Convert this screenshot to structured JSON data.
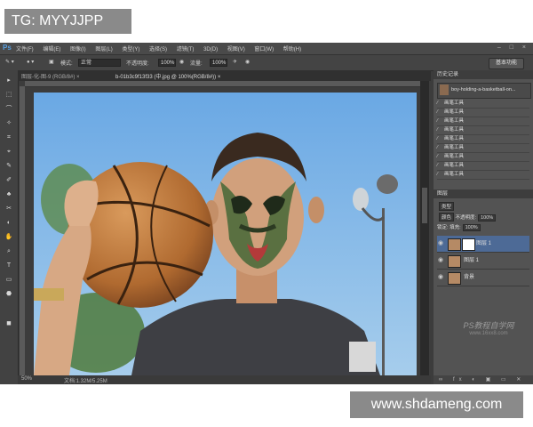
{
  "tag": "TG: MYYJJPP",
  "site_url": "www.shdameng.com",
  "app": {
    "logo": "Ps",
    "menu": [
      "文件(F)",
      "编辑(E)",
      "图像(I)",
      "图层(L)",
      "类型(Y)",
      "选择(S)",
      "滤镜(T)",
      "3D(D)",
      "视图(V)",
      "窗口(W)",
      "帮助(H)"
    ],
    "window_controls": "– □ ×"
  },
  "options_bar": {
    "mode_label": "模式:",
    "mode_value": "正常",
    "opacity_label": "不透明度:",
    "opacity_value": "100%",
    "flow_label": "流量:",
    "flow_value": "100%",
    "workspace": "基本功能"
  },
  "doc_tabs": [
    "图层-化-图-9 (RGB/8#) ×",
    "b-01b3c9f13f33 (中.jpg @ 100%(RGB/8#)) ×"
  ],
  "status": {
    "zoom": "50%",
    "doc_size": "文档:1.32M/5.25M"
  },
  "history": {
    "title": "历史记录",
    "snapshot": "boy-holding-a-basketball-on...",
    "steps": [
      "画笔工具",
      "画笔工具",
      "画笔工具",
      "画笔工具",
      "画笔工具",
      "画笔工具",
      "画笔工具",
      "画笔工具",
      "画笔工具"
    ]
  },
  "layers": {
    "title": "图层",
    "kind_label": "类型",
    "blend_mode": "颜色",
    "opacity_label": "不透明度:",
    "opacity_value": "100%",
    "lock_label": "锁定:",
    "fill_label": "填充:",
    "fill_value": "100%",
    "items": [
      {
        "name": "图层 1",
        "selected": true,
        "mask": true
      },
      {
        "name": "图层 1",
        "selected": false,
        "mask": false
      },
      {
        "name": "背景",
        "selected": false,
        "mask": false
      }
    ]
  },
  "watermark": {
    "line1": "PS教程自学网",
    "line2": "www.16xx8.com"
  },
  "tools": [
    "▸",
    "⬚",
    "⌒",
    "✧",
    "⌗",
    "⌖",
    "✎",
    "✐",
    "♣",
    "✂",
    "◐",
    "✋",
    "⌕",
    "T",
    "▭",
    "⬣",
    "■"
  ]
}
